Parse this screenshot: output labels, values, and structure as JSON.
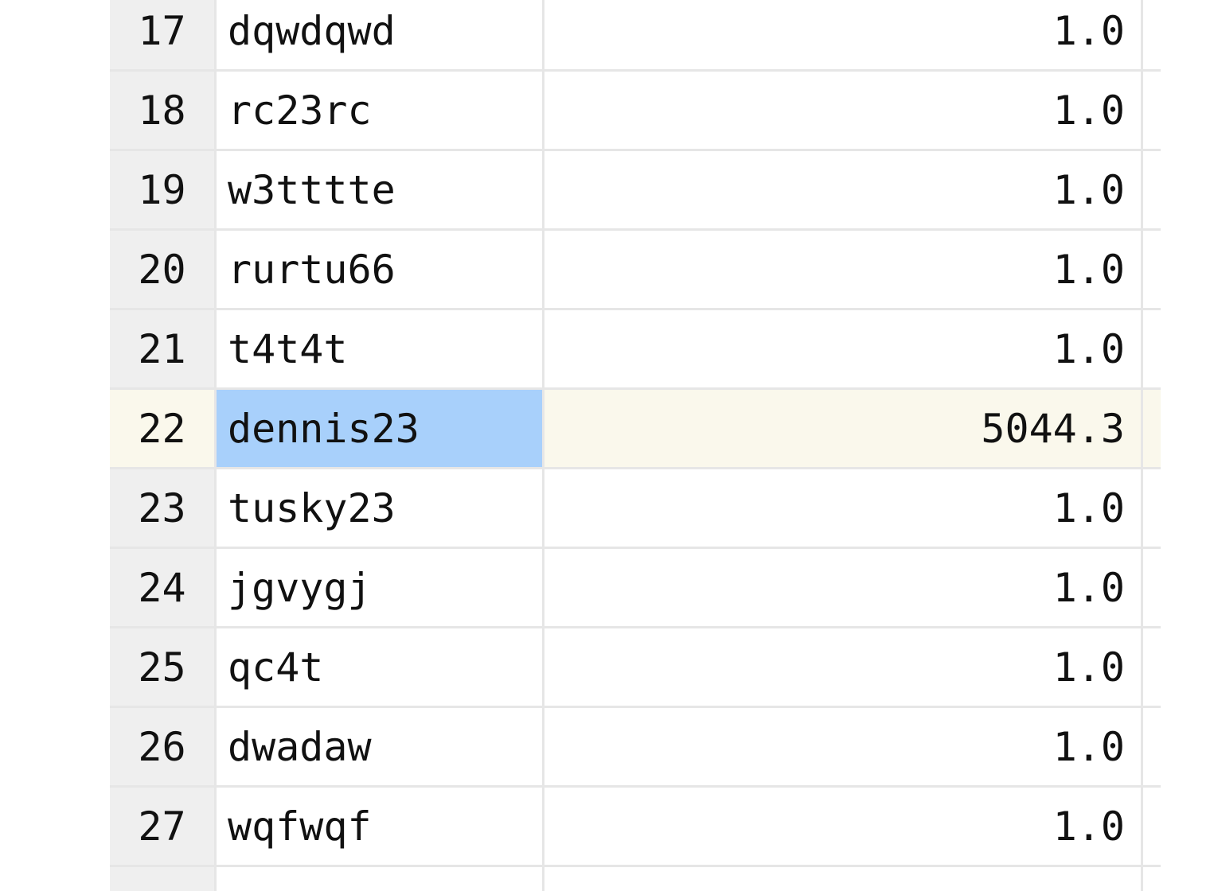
{
  "table": {
    "rows": [
      {
        "num": "17",
        "name": "dqwdqwd",
        "value": "1.0"
      },
      {
        "num": "18",
        "name": "rc23rc",
        "value": "1.0"
      },
      {
        "num": "19",
        "name": "w3tttte",
        "value": "1.0"
      },
      {
        "num": "20",
        "name": "rurtu66",
        "value": "1.0"
      },
      {
        "num": "21",
        "name": "t4t4t",
        "value": "1.0"
      },
      {
        "num": "22",
        "name": "dennis23",
        "value": "5044.3"
      },
      {
        "num": "23",
        "name": "tusky23",
        "value": "1.0"
      },
      {
        "num": "24",
        "name": "jgvygj",
        "value": "1.0"
      },
      {
        "num": "25",
        "name": "qc4t",
        "value": "1.0"
      },
      {
        "num": "26",
        "name": "dwadaw",
        "value": "1.0"
      },
      {
        "num": "27",
        "name": "wqfwqf",
        "value": "1.0"
      }
    ],
    "selected_row_index": 5,
    "colors": {
      "selected_cell": "#a8d0fb",
      "current_row": "#faf8ec",
      "row_header": "#efefef",
      "grid_line": "#e6e6e6"
    }
  }
}
